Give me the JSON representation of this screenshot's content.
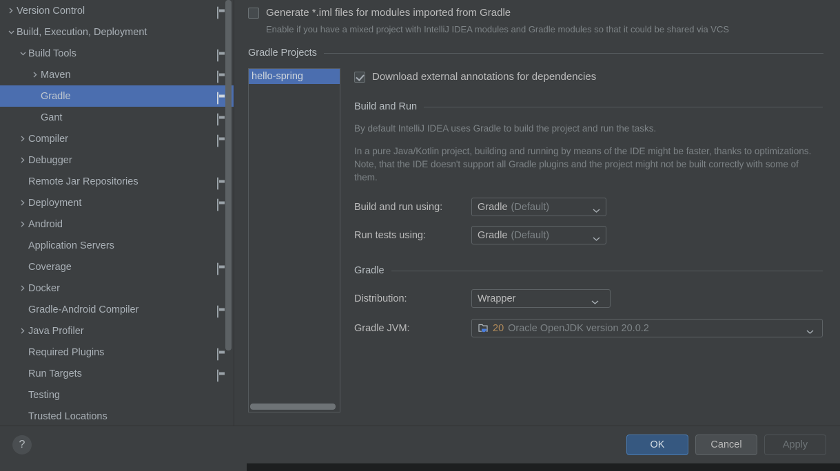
{
  "sidebar": {
    "items": [
      {
        "label": "Version Control",
        "level": 0,
        "arrow": "right",
        "badge": true
      },
      {
        "label": "Build, Execution, Deployment",
        "level": 0,
        "arrow": "down",
        "badge": false
      },
      {
        "label": "Build Tools",
        "level": 1,
        "arrow": "down",
        "badge": true
      },
      {
        "label": "Maven",
        "level": 2,
        "arrow": "right",
        "badge": true
      },
      {
        "label": "Gradle",
        "level": 2,
        "arrow": "none",
        "badge": true,
        "selected": true
      },
      {
        "label": "Gant",
        "level": 2,
        "arrow": "none",
        "badge": true
      },
      {
        "label": "Compiler",
        "level": 1,
        "arrow": "right",
        "badge": true
      },
      {
        "label": "Debugger",
        "level": 1,
        "arrow": "right",
        "badge": false
      },
      {
        "label": "Remote Jar Repositories",
        "level": 1,
        "arrow": "none",
        "badge": true
      },
      {
        "label": "Deployment",
        "level": 1,
        "arrow": "right",
        "badge": true
      },
      {
        "label": "Android",
        "level": 1,
        "arrow": "right",
        "badge": false
      },
      {
        "label": "Application Servers",
        "level": 1,
        "arrow": "none",
        "badge": false
      },
      {
        "label": "Coverage",
        "level": 1,
        "arrow": "none",
        "badge": true
      },
      {
        "label": "Docker",
        "level": 1,
        "arrow": "right",
        "badge": false
      },
      {
        "label": "Gradle-Android Compiler",
        "level": 1,
        "arrow": "none",
        "badge": true
      },
      {
        "label": "Java Profiler",
        "level": 1,
        "arrow": "right",
        "badge": false
      },
      {
        "label": "Required Plugins",
        "level": 1,
        "arrow": "none",
        "badge": true
      },
      {
        "label": "Run Targets",
        "level": 1,
        "arrow": "none",
        "badge": true
      },
      {
        "label": "Testing",
        "level": 1,
        "arrow": "none",
        "badge": false
      },
      {
        "label": "Trusted Locations",
        "level": 1,
        "arrow": "none",
        "badge": false
      }
    ]
  },
  "content": {
    "generate_iml": {
      "label": "Generate *.iml files for modules imported from Gradle",
      "checked": false,
      "hint": "Enable if you have a mixed project with IntelliJ IDEA modules and Gradle modules so that it could be shared via VCS"
    },
    "gradle_projects_group": "Gradle Projects",
    "project_list": [
      {
        "name": "hello-spring",
        "selected": true
      }
    ],
    "download_annotations": {
      "label": "Download external annotations for dependencies",
      "checked": true
    },
    "build_and_run_group": "Build and Run",
    "build_run_para1": "By default IntelliJ IDEA uses Gradle to build the project and run the tasks.",
    "build_run_para2": "In a pure Java/Kotlin project, building and running by means of the IDE might be faster, thanks to optimizations. Note, that the IDE doesn't support all Gradle plugins and the project might not be built correctly with some of them.",
    "build_and_run_using": {
      "label": "Build and run using:",
      "value": "Gradle",
      "value_suffix": "(Default)"
    },
    "run_tests_using": {
      "label": "Run tests using:",
      "value": "Gradle",
      "value_suffix": "(Default)"
    },
    "gradle_group": "Gradle",
    "distribution": {
      "label": "Distribution:",
      "value": "Wrapper"
    },
    "gradle_jvm": {
      "label": "Gradle JVM:",
      "version": "20",
      "description": "Oracle OpenJDK version 20.0.2",
      "icon": "jdk-folder-icon"
    }
  },
  "footer": {
    "help_label": "?",
    "ok_label": "OK",
    "cancel_label": "Cancel",
    "apply_label": "Apply"
  },
  "colors": {
    "accent": "#4b6eaf",
    "primary_button": "#365880",
    "background": "#3c3f41",
    "text": "#bbbbbb",
    "muted_text": "#7d8386",
    "jdk_version": "#b08a5a"
  }
}
